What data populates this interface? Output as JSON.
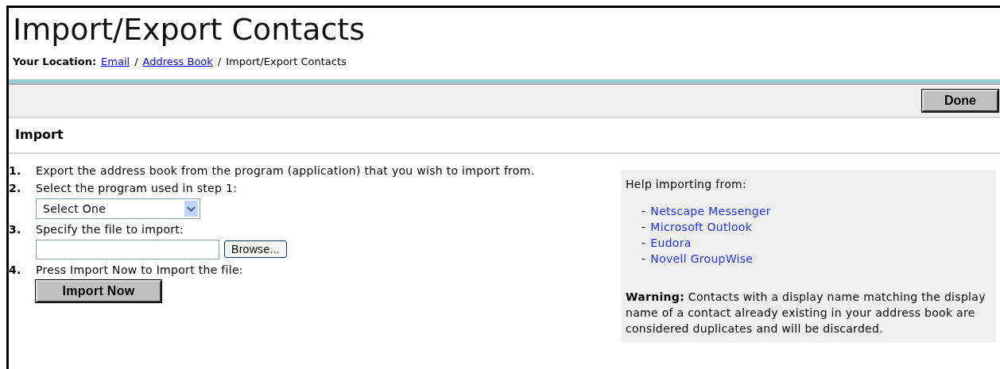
{
  "page": {
    "title": "Import/Export Contacts"
  },
  "breadcrumb": {
    "label": "Your Location:",
    "links": [
      "Email",
      "Address Book"
    ],
    "separator": "/",
    "current": "Import/Export Contacts"
  },
  "toolbar": {
    "buttons": [
      "Done"
    ]
  },
  "import": {
    "heading": "Import",
    "steps": [
      {
        "number": "1.",
        "kind": "text",
        "text": "Export the address book from the program (application) that you wish to import from."
      },
      {
        "number": "2.",
        "kind": "select",
        "text": "Select the program used in step 1:",
        "value": "Select One"
      },
      {
        "number": "3.",
        "kind": "file",
        "text": "Specify the file to import:",
        "button": "Browse..."
      },
      {
        "number": "4.",
        "kind": "button",
        "text": "Press Import Now to Import the file:",
        "button": "Import Now"
      }
    ]
  },
  "help": {
    "intro": "Help importing from:",
    "links": [
      {
        "bullet": "-",
        "label": "Netscape Messenger"
      },
      {
        "bullet": "-",
        "label": "Microsoft Outlook"
      },
      {
        "bullet": "-",
        "label": "Eudora"
      },
      {
        "bullet": "-",
        "label": "Novell GroupWise"
      }
    ],
    "warning": "**Warning:** Contacts with a display name matching the display name of a contact already existing in your address book are considered duplicates and will be discarded."
  }
}
